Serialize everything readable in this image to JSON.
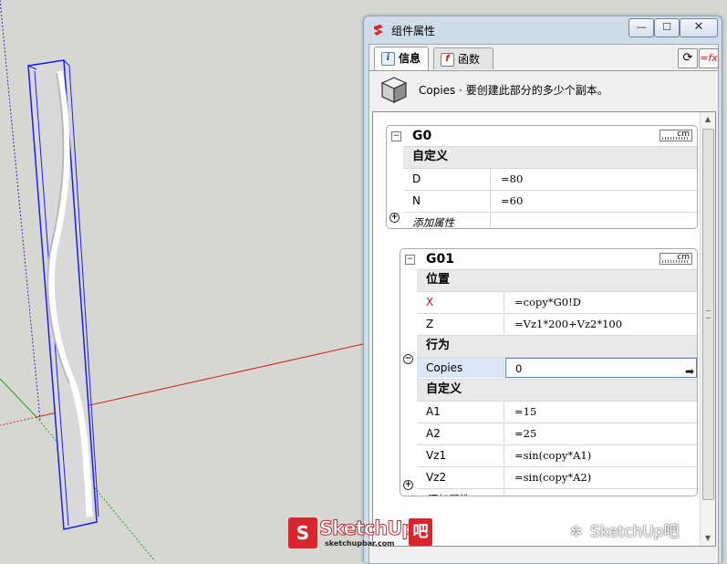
{
  "window": {
    "title": "组件属性",
    "min_symbol": "—",
    "max_symbol": "☐",
    "close_symbol": "✕"
  },
  "tabs": [
    {
      "label": "信息",
      "icon": "info-icon",
      "active": true
    },
    {
      "label": "函数",
      "icon": "fx-icon",
      "active": false
    }
  ],
  "toolbar": {
    "refresh_symbol": "⟳",
    "fx_symbol": "=fx"
  },
  "info": {
    "text": "Copies · 要创建此部分的多少个副本。"
  },
  "units_label": "cm",
  "groups": {
    "g0": {
      "name": "G0",
      "sections": [
        {
          "title": "自定义",
          "rows": [
            {
              "name": "D",
              "value": "=80"
            },
            {
              "name": "N",
              "value": "=60"
            }
          ]
        }
      ],
      "add_label": "添加属性"
    },
    "g01": {
      "name": "G01",
      "sections": [
        {
          "title": "位置",
          "rows": [
            {
              "name": "X",
              "value": "=copy*G0!D",
              "name_color": "#b22020"
            },
            {
              "name": "Z",
              "value": "=Vz1*200+Vz2*100"
            }
          ]
        },
        {
          "title": "行为",
          "rows": [
            {
              "name": "Copies",
              "value": "0",
              "selected": true
            }
          ]
        },
        {
          "title": "自定义",
          "rows": [
            {
              "name": "A1",
              "value": "=15"
            },
            {
              "name": "A2",
              "value": "=25"
            },
            {
              "name": "Vz1",
              "value": "=sin(copy*A1)"
            },
            {
              "name": "Vz2",
              "value": "=sin(copy*A2)"
            }
          ]
        }
      ],
      "add_label": "添加属性"
    }
  },
  "watermark": {
    "logo_text": "SketchUp",
    "logo_suffix": "吧",
    "logo_site": "sketchupbar.com",
    "wechat_text": "SketchUp吧"
  }
}
